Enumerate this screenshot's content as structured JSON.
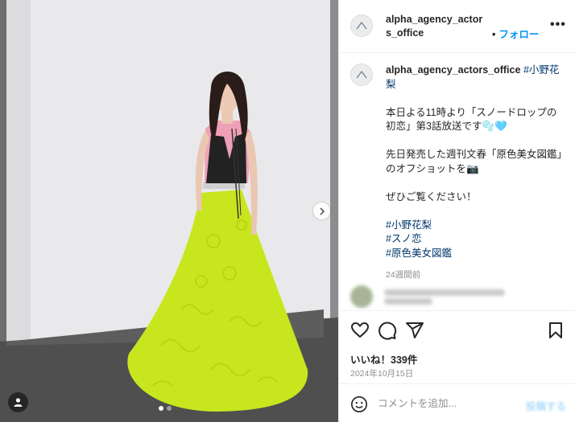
{
  "post": {
    "username": "alpha_agency_actors_office",
    "follow_separator": "•",
    "follow_label": "フォロー",
    "more_label": "•••"
  },
  "caption": {
    "username": "alpha_agency_actors_office",
    "lead_tag": "#小野花梨",
    "line1": "本日よる11時より「スノードロップの初恋」第3話放送です🫧🩵",
    "line2": "先日発売した週刊文春「原色美女図鑑」のオフショットを📷",
    "line3": "ぜひご覧ください！",
    "hashtags": [
      "#小野花梨",
      "#スノ恋",
      "#原色美女図鑑"
    ],
    "time": "24週間前"
  },
  "actions": {
    "likes": "いいね！339件",
    "date": "2024年10月15日"
  },
  "comment_box": {
    "placeholder": "コメントを追加...",
    "post_label": "投稿する"
  },
  "icons": {
    "like": "heart-icon",
    "comment": "comment-icon",
    "share": "share-icon",
    "save": "bookmark-icon",
    "emoji": "smiley-icon",
    "next": "chevron-right-icon",
    "tags": "person-tag-icon"
  },
  "carousel": {
    "slides": 2,
    "current": 1
  },
  "colors": {
    "link": "#0095f6",
    "hashtag": "#00376b",
    "muted": "#8e8e8e",
    "dress": "#c8e61e"
  }
}
